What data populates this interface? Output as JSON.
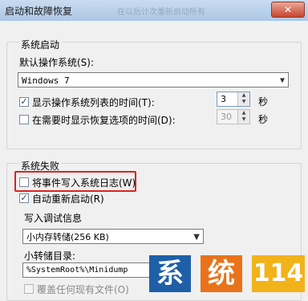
{
  "window": {
    "title": "启动和故障恢复",
    "title_faded": "在以后计次重新启动所有",
    "close_glyph": "✕"
  },
  "system_startup": {
    "group_label": "系统启动",
    "default_os_label": "默认操作系统(S):",
    "default_os_value": "Windows 7",
    "show_os_list_label": "显示操作系统列表的时间(T):",
    "show_os_list_checked": true,
    "show_os_list_value": "3",
    "show_os_list_unit": "秒",
    "show_recovery_label": "在需要时显示恢复选项的时间(D):",
    "show_recovery_checked": false,
    "show_recovery_value": "30",
    "show_recovery_unit": "秒"
  },
  "system_failure": {
    "group_label": "系统失败",
    "write_event_label": "将事件写入系统日志(W)",
    "write_event_checked": false,
    "auto_restart_label": "自动重新启动(R)",
    "auto_restart_checked": true,
    "debug_info_label": "写入调试信息",
    "debug_info_value": "小内存转储(256 KB)",
    "dump_dir_label": "小转储目录:",
    "dump_dir_value": "%SystemRoot%\\Minidump",
    "overwrite_label": "覆盖任何现有文件(O)",
    "overwrite_checked": false
  },
  "watermark": {
    "chars": [
      "系",
      "统",
      "114"
    ],
    "colors": [
      "#1e5fa8",
      "#e8731a",
      "#f2b21a"
    ]
  }
}
